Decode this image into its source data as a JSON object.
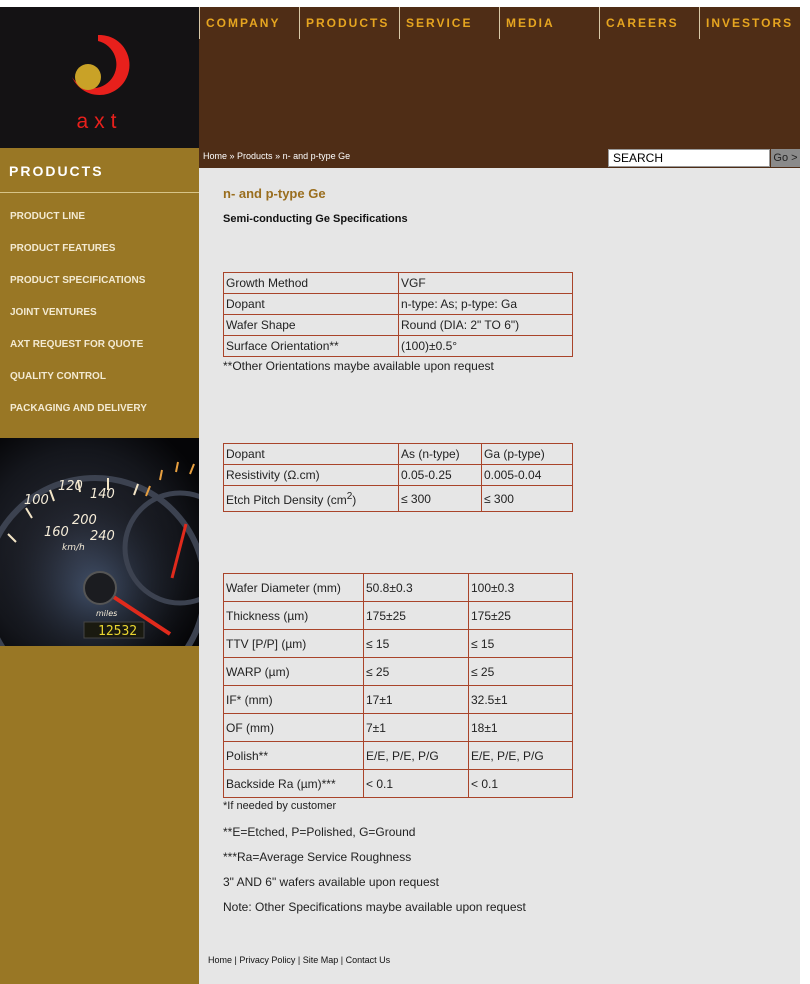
{
  "brand": {
    "name": "axt"
  },
  "topnav": [
    "COMPANY",
    "PRODUCTS",
    "SERVICE",
    "MEDIA",
    "CAREERS",
    "INVESTORS"
  ],
  "sidebar": {
    "title": "PRODUCTS",
    "items": [
      "PRODUCT LINE",
      "PRODUCT FEATURES",
      "PRODUCT SPECIFICATIONS",
      "JOINT VENTURES",
      "AXT REQUEST FOR QUOTE",
      "QUALITY CONTROL",
      "PACKAGING AND DELIVERY"
    ]
  },
  "breadcrumb": {
    "home": "Home",
    "sep": " » ",
    "products": "Products",
    "current": "n- and p-type Ge"
  },
  "search": {
    "value": "SEARCH",
    "go": "Go >"
  },
  "page": {
    "title": "n- and p-type Ge",
    "subtitle": "Semi-conducting Ge Specifications"
  },
  "table1": [
    [
      "Growth Method",
      "VGF"
    ],
    [
      "Dopant",
      "n-type: As; p-type: Ga"
    ],
    [
      "Wafer Shape",
      "Round (DIA: 2\" TO 6\")"
    ],
    [
      "Surface Orientation**",
      "(100)±0.5°"
    ]
  ],
  "note1": "**Other Orientations maybe available upon request",
  "table2": {
    "header": [
      "Dopant",
      "As (n-type)",
      "Ga (p-type)"
    ],
    "resistivity": [
      "Resistivity  (Ω.cm)",
      "0.05-0.25",
      "0.005-0.04"
    ],
    "epd": {
      "label": "Etch Pitch Density (cm",
      "sup": "2",
      "close": ")",
      "n": "≤ 300",
      "p": "≤ 300"
    }
  },
  "table3": [
    [
      "Wafer Diameter (mm)",
      "50.8±0.3",
      "100±0.3"
    ],
    [
      "Thickness (µm)",
      "175±25",
      "175±25"
    ],
    [
      "TTV [P/P] (µm)",
      "≤ 15",
      "≤ 15"
    ],
    [
      "WARP (µm)",
      "≤ 25",
      "≤ 25"
    ],
    [
      "IF* (mm)",
      "17±1",
      "32.5±1"
    ],
    [
      "OF (mm)",
      "7±1",
      "18±1"
    ],
    [
      "Polish**",
      "E/E, P/E, P/G",
      "E/E, P/E, P/G"
    ],
    [
      "Backside Ra (µm)***",
      "< 0.1",
      "< 0.1"
    ]
  ],
  "notes": [
    "*If needed by customer",
    "**E=Etched, P=Polished, G=Ground",
    "***Ra=Average Service Roughness",
    "3\" AND 6\" wafers available upon request",
    "Note: Other Specifications maybe available upon request"
  ],
  "footer": {
    "home": "Home",
    "privacy": "Privacy Policy",
    "sitemap": "Site Map",
    "contact": "Contact Us",
    "sep": " | "
  },
  "gauge": {
    "speed_labels": [
      "100",
      "120",
      "140",
      "160",
      "200",
      "240"
    ],
    "unit": "km/h",
    "odometer": "12532",
    "miles": "miles"
  },
  "colors": {
    "header_brown": "#4f2d16",
    "sidebar_gold": "#997725",
    "nav_gold": "#e6a520",
    "logo_red": "#e8201c",
    "table_border": "#a9442a",
    "title_gold": "#9a6e1e"
  }
}
